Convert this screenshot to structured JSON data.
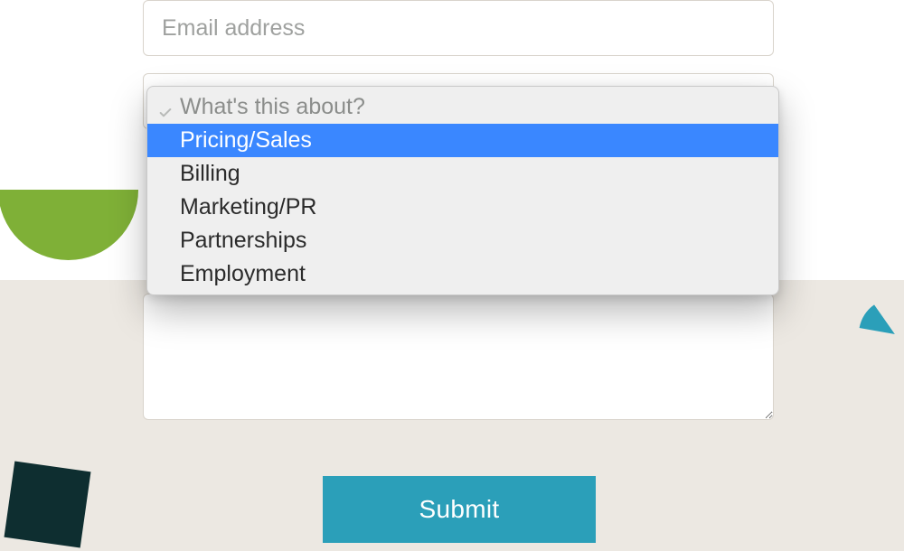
{
  "form": {
    "email_placeholder": "Email address",
    "select": {
      "placeholder": "What's this about?"
    },
    "submit_label": "Submit"
  },
  "dropdown": {
    "placeholder": "What's this about?",
    "options": [
      {
        "label": "Pricing/Sales",
        "highlighted": true
      },
      {
        "label": "Billing",
        "highlighted": false
      },
      {
        "label": "Marketing/PR",
        "highlighted": false
      },
      {
        "label": "Partnerships",
        "highlighted": false
      },
      {
        "label": "Employment",
        "highlighted": false
      }
    ]
  },
  "colors": {
    "accent": "#2b9fb9",
    "highlight": "#3a87ff",
    "green_shape": "#7fb037"
  }
}
